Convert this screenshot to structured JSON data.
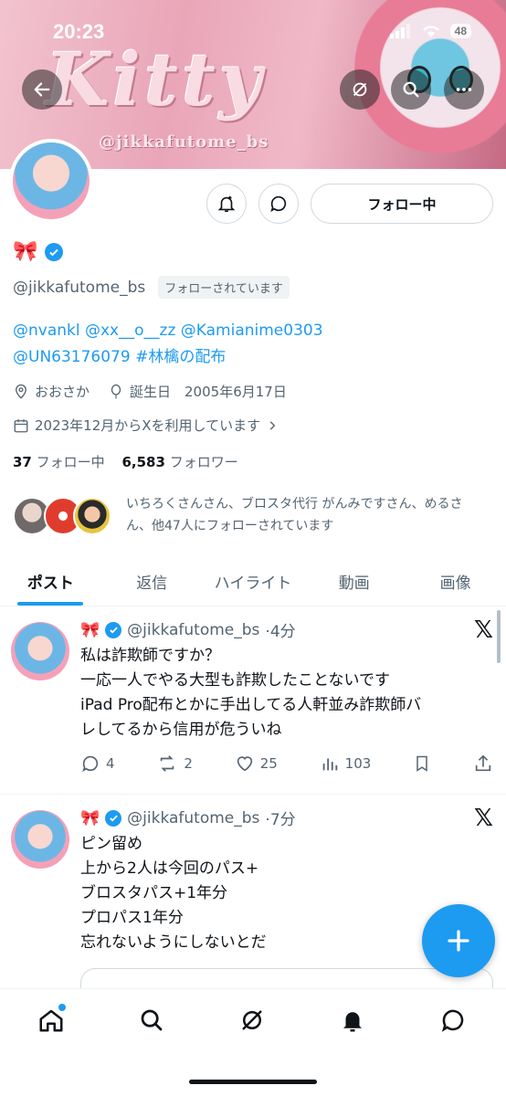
{
  "status_bar": {
    "time": "20:23",
    "battery": "48"
  },
  "banner": {
    "title": "Kitty",
    "handle": "@jikkafutome_bs"
  },
  "profile": {
    "display_name_emoji": "🎀",
    "handle": "@jikkafutome_bs",
    "follows_you": "フォローされています",
    "follow_button": "フォロー中",
    "bio_line1": "@nvankl @xx__o__zz @Kamianime0303",
    "bio_line2": "@UN63176079 #林檎の配布",
    "location": "おおさか",
    "birthday": "誕生日　2005年6月17日",
    "joined": "2023年12月からXを利用しています",
    "following_count": "37",
    "following_label": "フォロー中",
    "followers_count": "6,583",
    "followers_label": "フォロワー",
    "followed_by": "いちろくさんさん、ブロスタ代行 がんみですさん、めるさん、他47人にフォローされています"
  },
  "tabs": [
    "ポスト",
    "返信",
    "ハイライト",
    "動画",
    "画像"
  ],
  "posts": [
    {
      "name": "🎀",
      "handle": "@jikkafutome_bs",
      "time": "·4分",
      "lines": [
        "私は詐欺師ですか？",
        "一応一人でやる大型も詐欺したことないです",
        "iPad Pro配布とかに手出してる人軒並み詐欺師バ",
        "レしてるから信用が危ういね"
      ],
      "replies": "4",
      "reposts": "2",
      "likes": "25",
      "views": "103"
    },
    {
      "name": "🎀",
      "handle": "@jikkafutome_bs",
      "time": "·7分",
      "lines": [
        "ピン留め",
        "上から2人は今回のパス+",
        "ブロスタパス+1年分",
        "プロパス1年分",
        "忘れないようにしないとだ"
      ]
    }
  ],
  "colors": {
    "accent": "#1d9bf0",
    "text": "#0f1419",
    "muted": "#536471"
  }
}
